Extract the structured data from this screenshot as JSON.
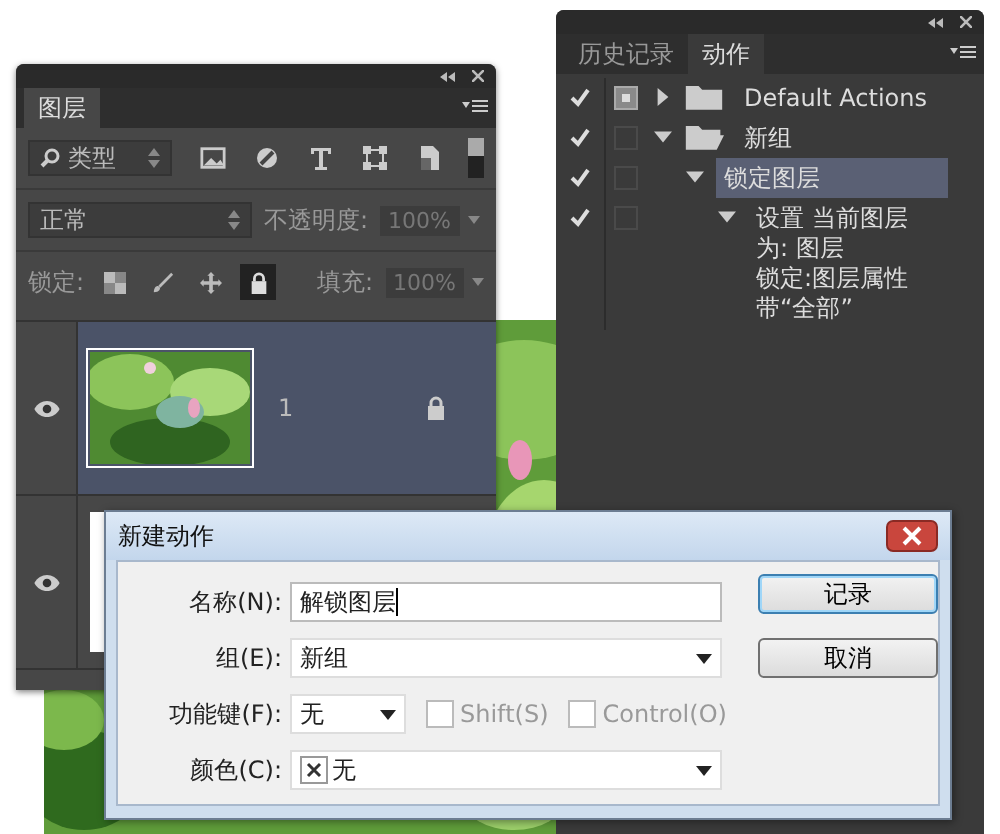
{
  "layers_panel": {
    "tab": "图层",
    "filter": {
      "value": "类型"
    },
    "blend_mode": "正常",
    "opacity_label": "不透明度:",
    "opacity": "100%",
    "lock_label": "锁定:",
    "locks": [
      {
        "kind": "pixels",
        "selected": false
      },
      {
        "kind": "paint",
        "selected": false
      },
      {
        "kind": "move",
        "selected": false
      },
      {
        "kind": "all",
        "selected": true
      }
    ],
    "fill_label": "填充:",
    "fill": "100%",
    "layers": [
      {
        "name": "1",
        "visible": true,
        "selected": true,
        "locked": true,
        "kind": "picture"
      },
      {
        "visible": true,
        "selected": false,
        "locked": false,
        "kind": "blank"
      }
    ]
  },
  "actions_panel": {
    "tabs": [
      {
        "label": "历史记录",
        "selected": false
      },
      {
        "label": "动作",
        "selected": true
      }
    ],
    "items": [
      {
        "label": "Default Actions",
        "checked": true,
        "dialog": true,
        "expanded": false,
        "selected": false,
        "kind": "set"
      },
      {
        "label": "新组",
        "checked": true,
        "dialog": false,
        "expanded": true,
        "selected": false,
        "kind": "set",
        "children": [
          {
            "label": "锁定图层",
            "checked": true,
            "dialog": false,
            "expanded": true,
            "selected": true,
            "kind": "action",
            "children": [
              {
                "label": "设置 当前图层",
                "details": [
                  "为: 图层",
                  "锁定:图层属性",
                  "带“全部”"
                ],
                "checked": true,
                "dialog": false,
                "expanded": true,
                "selected": false,
                "kind": "command"
              }
            ]
          }
        ]
      }
    ]
  },
  "dialog": {
    "title": "新建动作",
    "fields": [
      {
        "label": "名称(N):",
        "kind": "text",
        "value": "解锁图层"
      },
      {
        "label": "组(E):",
        "kind": "select",
        "value": "新组"
      },
      {
        "label": "功能键(F):",
        "kind": "key",
        "value": "无",
        "options": [
          {
            "label": "Shift(S)",
            "checked": false,
            "disabled": true
          },
          {
            "label": "Control(O)",
            "checked": false,
            "disabled": true
          }
        ]
      },
      {
        "label": "颜色(C):",
        "kind": "color",
        "value": "无"
      }
    ],
    "buttons": [
      {
        "label": "记录",
        "default": true
      },
      {
        "label": "取消",
        "default": false
      }
    ]
  }
}
